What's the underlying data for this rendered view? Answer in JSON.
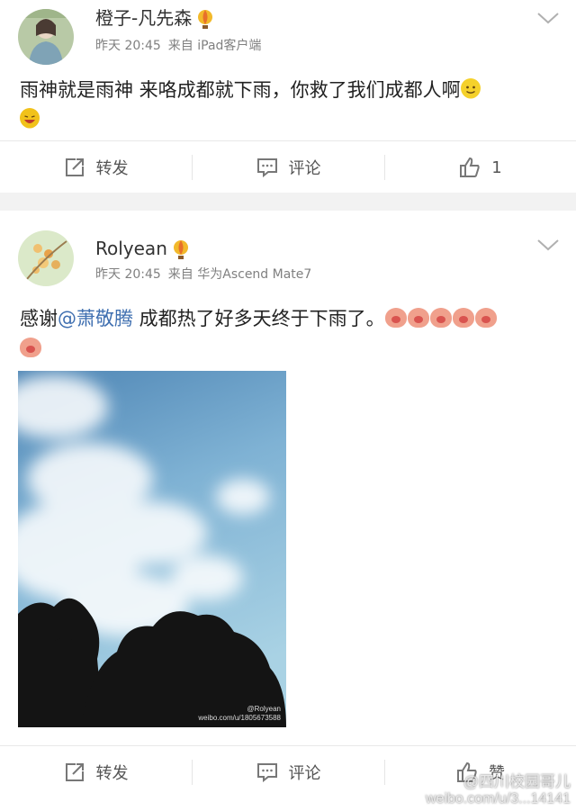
{
  "posts": [
    {
      "username": "橙子-凡先森",
      "time": "昨天 20:45",
      "source": "来自 iPad客户端",
      "text": "雨神就是雨神 来咯成都就下雨，你救了我们成都人啊",
      "emoticons": [
        "smile-emoticon",
        "laugh-emoticon"
      ],
      "actions": {
        "repost": "转发",
        "comment": "评论",
        "like_count": "1"
      }
    },
    {
      "username": "Rolyean",
      "time": "昨天 20:45",
      "source": "来自 华为Ascend Mate7",
      "text_prefix": "感谢",
      "mention": "@萧敬腾",
      "text_suffix": " 成都热了好多天终于下雨了。",
      "emoticon": "pig-emoticon",
      "emoticon_count": 6,
      "image_watermark": "weibo.com/u/1805673588",
      "image_watermark_handle": "@Rolyean",
      "actions": {
        "repost": "转发",
        "comment": "评论",
        "like": "赞"
      }
    }
  ],
  "overlay_watermark": {
    "line1": "@四川校园哥儿",
    "line2": "weibo.com/u/3...14141"
  },
  "colors": {
    "mention": "#3f6fb0",
    "background": "#f2f2f2",
    "card": "#ffffff"
  }
}
